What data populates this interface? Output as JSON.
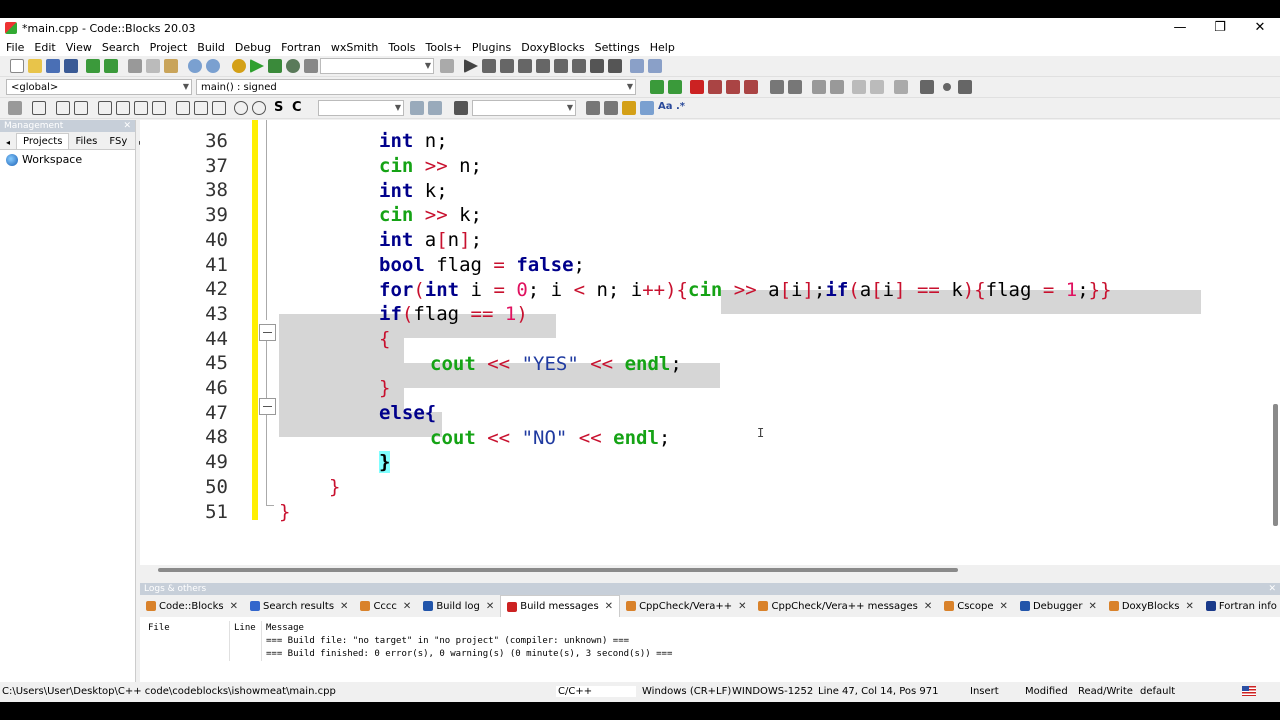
{
  "window": {
    "title": "*main.cpp - Code::Blocks 20.03",
    "minimize": "—",
    "restore": "❐",
    "close": "✕"
  },
  "menu": [
    "File",
    "Edit",
    "View",
    "Search",
    "Project",
    "Build",
    "Debug",
    "Fortran",
    "wxSmith",
    "Tools",
    "Tools+",
    "Plugins",
    "DoxyBlocks",
    "Settings",
    "Help"
  ],
  "toolbar": {
    "scope": "<global>",
    "function": "main() : signed"
  },
  "management": {
    "title": "Management",
    "tabs": [
      "Projects",
      "Files",
      "FSy"
    ],
    "workspace": "Workspace"
  },
  "editor": {
    "line_numbers": [
      "36",
      "37",
      "38",
      "39",
      "40",
      "41",
      "42",
      "43",
      "44",
      "45",
      "46",
      "47",
      "48",
      "49",
      "50",
      "51"
    ]
  },
  "logs": {
    "title": "Logs & others",
    "tabs": [
      {
        "label": "Code::Blocks",
        "color": "#d9822b"
      },
      {
        "label": "Search results",
        "color": "#3366cc"
      },
      {
        "label": "Cccc",
        "color": "#d9822b"
      },
      {
        "label": "Build log",
        "color": "#2255aa"
      },
      {
        "label": "Build messages",
        "color": "#cc2222"
      },
      {
        "label": "CppCheck/Vera++",
        "color": "#d9822b"
      },
      {
        "label": "CppCheck/Vera++ messages",
        "color": "#d9822b"
      },
      {
        "label": "Cscope",
        "color": "#d9822b"
      },
      {
        "label": "Debugger",
        "color": "#2255aa"
      },
      {
        "label": "DoxyBlocks",
        "color": "#d9822b"
      },
      {
        "label": "Fortran info",
        "color": "#1a3a8a"
      },
      {
        "label": "Close",
        "color": "#2a8a2a"
      }
    ],
    "columns": [
      "File",
      "Line",
      "Message"
    ],
    "messages": [
      "=== Build file: \"no target\" in \"no project\" (compiler: unknown) ===",
      "=== Build finished: 0 error(s), 0 warning(s) (0 minute(s), 3 second(s)) ==="
    ]
  },
  "status": {
    "path": "C:\\Users\\User\\Desktop\\C++ code\\codeblocks\\ishowmeat\\main.cpp",
    "lang": "C/C++",
    "eol": "Windows (CR+LF)",
    "encoding": "WINDOWS-1252",
    "position": "Line 47, Col 14, Pos 971",
    "mode": "Insert",
    "modified": "Modified",
    "access": "Read/Write",
    "profile": "default"
  }
}
